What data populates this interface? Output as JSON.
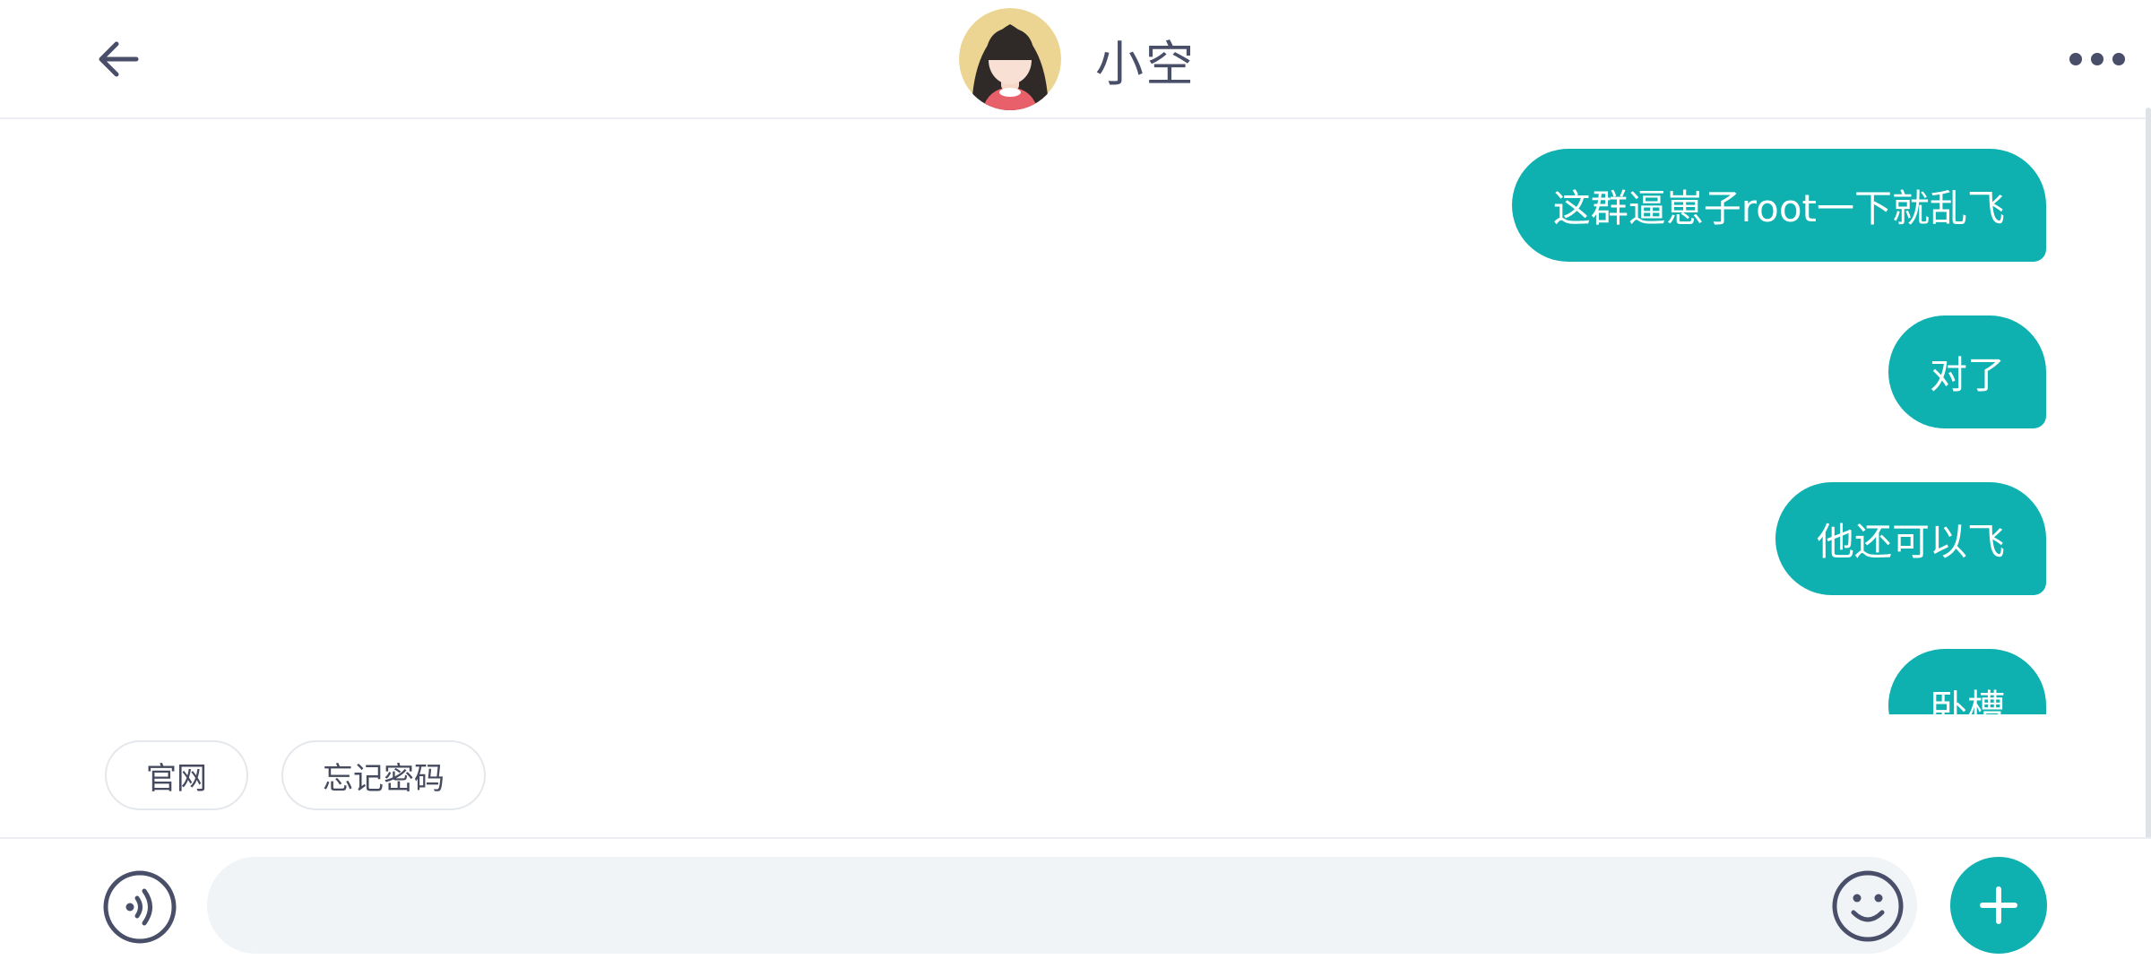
{
  "header": {
    "back_icon": "arrow-left-icon",
    "contact_name": "小空",
    "more_icon": "more-horizontal-icon"
  },
  "messages": [
    {
      "text": "这群逼崽子root一下就乱飞",
      "sender": "me"
    },
    {
      "text": "对了",
      "sender": "me"
    },
    {
      "text": "他还可以飞",
      "sender": "me"
    },
    {
      "text": "卧槽",
      "sender": "me"
    }
  ],
  "quick_replies": [
    "官网",
    "忘记密码"
  ],
  "input_bar": {
    "voice_icon": "voice-icon",
    "placeholder": "",
    "emoji_icon": "emoji-icon",
    "plus_icon": "plus-icon"
  },
  "colors": {
    "accent": "#0fb0b0",
    "text_dark": "#4a4f69",
    "input_bg": "#f1f4f7"
  }
}
